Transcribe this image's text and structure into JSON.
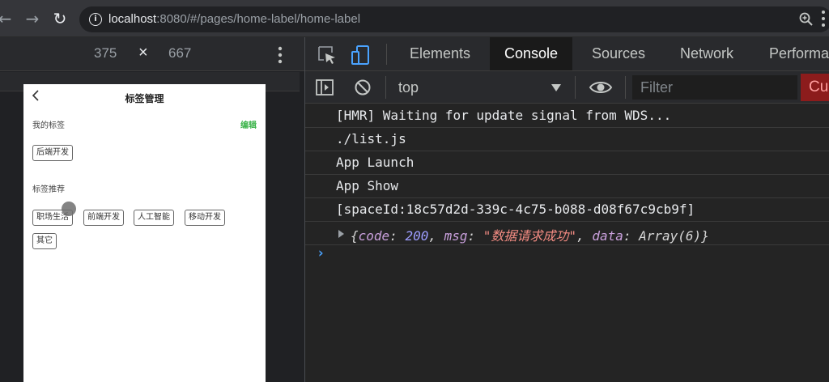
{
  "browser": {
    "url_host": "localhost",
    "url_rest": ":8080/#/pages/home-label/home-label"
  },
  "device_toolbar": {
    "width": "375",
    "times": "×",
    "height": "667"
  },
  "phone": {
    "title": "标签管理",
    "my_tags_title": "我的标签",
    "edit_label": "编辑",
    "my_tags": [
      "后端开发"
    ],
    "recommend_title": "标签推荐",
    "recommend_tags": [
      "职场生活",
      "前端开发",
      "人工智能",
      "移动开发",
      "其它"
    ]
  },
  "devtools": {
    "tabs": [
      "Elements",
      "Console",
      "Sources",
      "Network",
      "Performa"
    ],
    "active_tab": "Console",
    "context": "top",
    "filter_placeholder": "Filter",
    "custom_button": "Cu"
  },
  "console": {
    "lines": [
      "[HMR] Waiting for update signal from WDS...",
      "./list.js",
      "App Launch",
      "App Show",
      "[spaceId:18c57d2d-339c-4c75-b088-d08f67c9cb9f]"
    ],
    "object_line": {
      "open": "{",
      "code_key": "code",
      "code_val": "200",
      "msg_key": "msg",
      "msg_val": "\"数据请求成功\"",
      "data_key": "data",
      "data_val": "Array(6)",
      "close": "}"
    },
    "prompt": "›"
  },
  "colors": {
    "accent_green": "#3bb34a",
    "custom_red": "#8c1c1c",
    "prompt_blue": "#4aa3ff"
  }
}
